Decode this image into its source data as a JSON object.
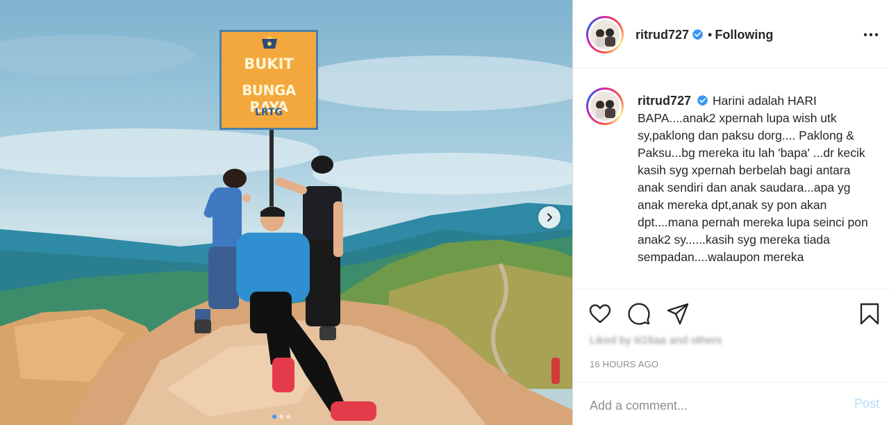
{
  "photo": {
    "sign": {
      "line1": "BUKIT",
      "line2": "BUNGA RAYA",
      "line3": "LRTG"
    },
    "next_icon": "chevron-right-icon",
    "carousel_total": 3,
    "carousel_active": 1
  },
  "post": {
    "username": "ritrud727",
    "verified_icon": "verified-badge-icon",
    "separator": "•",
    "follow_status": "Following",
    "more_icon": "more-options-icon",
    "caption": "Harini adalah HARI BAPA....anak2 xpernah lupa wish utk sy,paklong dan paksu dorg.... Paklong & Paksu...bg mereka itu lah 'bapa' ...dr kecik kasih syg xpernah berbelah bagi antara anak sendiri dan anak saudara...apa yg anak mereka dpt,anak sy pon akan dpt....mana pernah mereka lupa seinci pon anak2 sy......kasih syg mereka tiada sempadan....walaupon mereka",
    "likes_text": "Liked by iii16aa and others",
    "timestamp": "16 HOURS AGO"
  },
  "actions": {
    "like_icon": "heart-icon",
    "comment_icon": "comment-icon",
    "share_icon": "share-icon",
    "save_icon": "bookmark-icon"
  },
  "comment": {
    "placeholder": "Add a comment...",
    "post_label": "Post"
  },
  "colors": {
    "accent": "#3897f0",
    "post_disabled": "#b2dffc",
    "text": "#262626",
    "muted": "#8e8e8e",
    "sign": "#f3a83d"
  }
}
